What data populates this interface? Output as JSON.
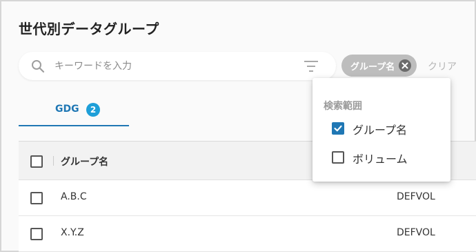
{
  "page": {
    "title": "世代別データグループ"
  },
  "search": {
    "placeholder": "キーワードを入力",
    "value": ""
  },
  "filter_chip": {
    "label": "グループ名"
  },
  "clear_label": "クリア",
  "tabs": [
    {
      "label": "GDG",
      "badge": "2",
      "active": true
    }
  ],
  "table": {
    "headers": [
      "グループ名"
    ],
    "rows": [
      {
        "name": "A.B.C",
        "volume": "DEFVOL",
        "checked": false
      },
      {
        "name": "X.Y.Z",
        "volume": "DEFVOL",
        "checked": false
      }
    ]
  },
  "search_scope_menu": {
    "title": "検索範囲",
    "options": [
      {
        "label": "グループ名",
        "checked": true
      },
      {
        "label": "ボリューム",
        "checked": false
      }
    ]
  },
  "colors": {
    "accent": "#1f77b4",
    "badge": "#1e9fd8",
    "chip": "#bdbdbd"
  }
}
